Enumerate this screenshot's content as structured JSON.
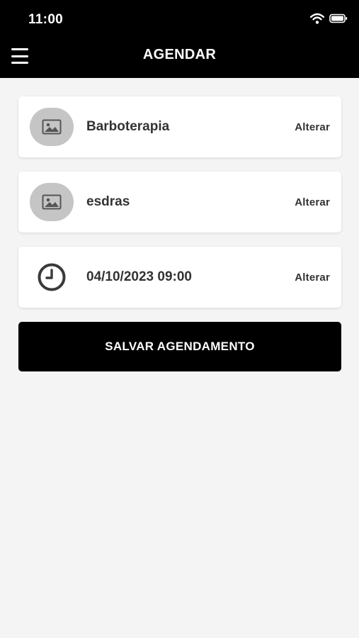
{
  "status_bar": {
    "time": "11:00"
  },
  "header": {
    "title": "AGENDAR"
  },
  "cards": [
    {
      "label": "Barboterapia",
      "action": "Alterar",
      "icon": "image-icon"
    },
    {
      "label": "esdras",
      "action": "Alterar",
      "icon": "image-icon"
    },
    {
      "label": "04/10/2023 09:00",
      "action": "Alterar",
      "icon": "clock-icon"
    }
  ],
  "save_button": {
    "label": "SALVAR AGENDAMENTO"
  },
  "colors": {
    "header_bg": "#000000",
    "page_bg": "#f4f4f4",
    "card_bg": "#ffffff",
    "thumb_bg": "#c5c5c5",
    "text": "#333333",
    "button_bg": "#000000"
  }
}
